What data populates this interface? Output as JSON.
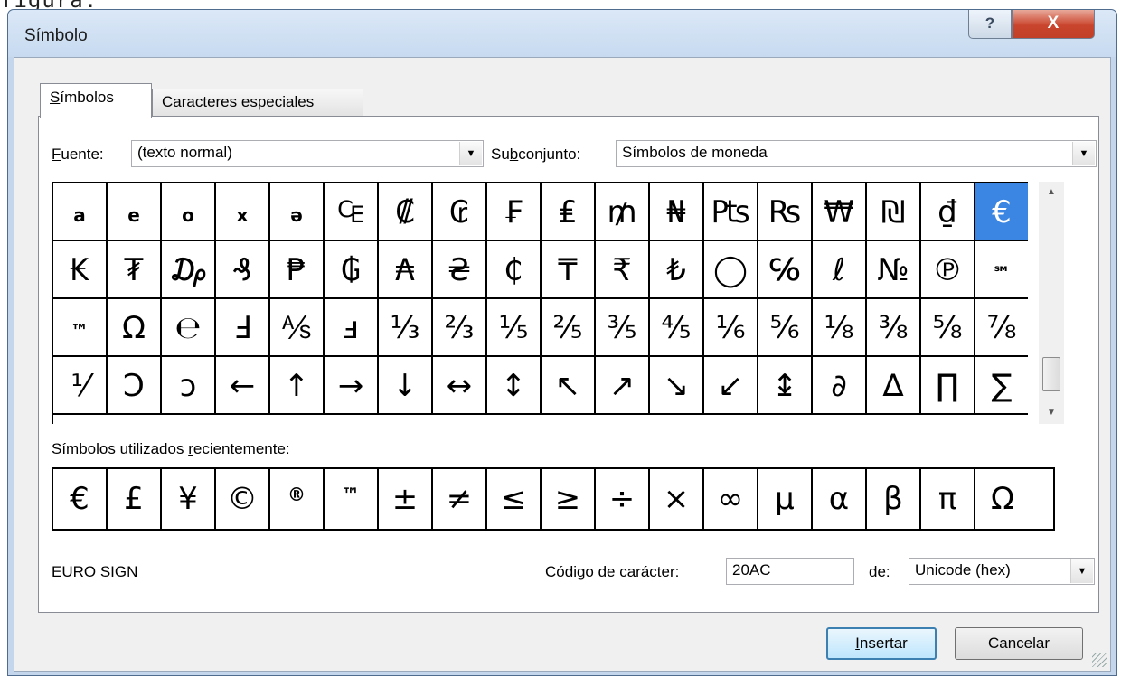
{
  "cropped_text": "figura.",
  "window": {
    "title": "Símbolo",
    "help_label": "?",
    "close_label": "X"
  },
  "tabs": [
    {
      "label": "Símbolos",
      "accel": "S",
      "rest": "ímbolos",
      "active": true
    },
    {
      "pre": "Caracteres ",
      "accel": "e",
      "post": "speciales",
      "label": "Caracteres especiales",
      "active": false
    }
  ],
  "font": {
    "label_accel": "F",
    "label_rest": "uente:",
    "value": "(texto normal)"
  },
  "subset": {
    "label_pre": "Su",
    "label_accel": "b",
    "label_post": "conjunto:",
    "value": "Símbolos de moneda"
  },
  "symbols": [
    [
      "a",
      "e",
      "o",
      "x",
      "ə",
      "₠",
      "₡",
      "₢",
      "₣",
      "₤",
      "₥",
      "₦",
      "₧",
      "₨",
      "₩",
      "₪",
      "₫",
      "€"
    ],
    [
      "₭",
      "₮",
      "₯",
      "₰",
      "₱",
      "₲",
      "₳",
      "₴",
      "₵",
      "₸",
      "₹",
      "₺",
      "◯",
      "℅",
      "ℓ",
      "№",
      "℗",
      "℠"
    ],
    [
      "™",
      "Ω",
      "℮",
      "Ⅎ",
      "⅍",
      "ⅎ",
      "⅓",
      "⅔",
      "⅕",
      "⅖",
      "⅗",
      "⅘",
      "⅙",
      "⅚",
      "⅛",
      "⅜",
      "⅝",
      "⅞"
    ],
    [
      "⅟",
      "Ↄ",
      "ↄ",
      "←",
      "↑",
      "→",
      "↓",
      "↔",
      "↕",
      "↖",
      "↗",
      "↘",
      "↙",
      "↨",
      "∂",
      "∆",
      "∏",
      "∑"
    ]
  ],
  "selected_symbol": "€",
  "recent": {
    "label_pre": "Símbolos utilizados ",
    "label_accel": "r",
    "label_post": "ecientemente:",
    "items": [
      "€",
      "£",
      "¥",
      "©",
      "®",
      "™",
      "±",
      "≠",
      "≤",
      "≥",
      "÷",
      "×",
      "∞",
      "µ",
      "α",
      "β",
      "π",
      "Ω"
    ]
  },
  "char_name": "EURO SIGN",
  "char_code": {
    "label_accel": "C",
    "label_rest": "ódigo de carácter:",
    "value": "20AC"
  },
  "from": {
    "label_accel": "d",
    "label_rest": "e:",
    "value": "Unicode (hex)"
  },
  "buttons": {
    "insert_accel": "I",
    "insert_rest": "nsertar",
    "cancel": "Cancelar"
  },
  "colors": {
    "selection": "#3a86e2",
    "title_bar": "#c7daf0",
    "close_button": "#c9452d"
  }
}
